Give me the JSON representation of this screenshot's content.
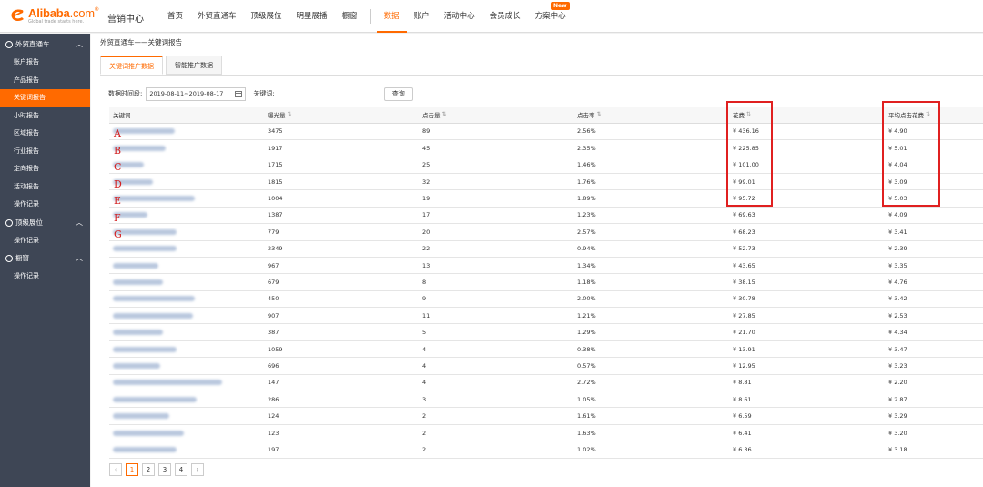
{
  "header": {
    "logo_main": "Alibaba",
    "logo_dom": ".com",
    "logo_reg": "®",
    "logo_sub": "Global trade starts here.",
    "title": "营销中心",
    "nav": [
      "首页",
      "外贸直通车",
      "顶级展位",
      "明星展播",
      "橱窗"
    ],
    "nav2": [
      "数据",
      "账户",
      "活动中心",
      "会员成长",
      "方案中心"
    ],
    "active": "数据",
    "new_badge": "New",
    "accent": "#ff6a00"
  },
  "sidebar": {
    "groups": [
      {
        "label": "外贸直通车",
        "items": [
          "账户报告",
          "产品报告",
          "关键词报告",
          "小时报告",
          "区域报告",
          "行业报告",
          "定向报告",
          "活动报告",
          "操作记录"
        ]
      },
      {
        "label": "顶级展位",
        "items": [
          "操作记录"
        ]
      },
      {
        "label": "橱窗",
        "items": [
          "操作记录"
        ]
      }
    ],
    "active_item": "关键词报告",
    "bg": "#3e4655"
  },
  "main": {
    "breadcrumb": "外贸直通车——关键词报告",
    "tabs": [
      "关键词推广数据",
      "智能推广数据"
    ],
    "filters": {
      "date_label": "数据时间段:",
      "date_value": "2019-08-11~2019-08-17",
      "keyword_label": "关键词:",
      "query_button": "查询"
    },
    "columns": [
      "关键词",
      "曝光量",
      "点击量",
      "点击率",
      "花费",
      "平均点击花费"
    ],
    "rows": [
      {
        "imp": "3475",
        "clk": "89",
        "ctr": "2.56%",
        "cost": "¥ 436.16",
        "cpc": "¥ 4.90"
      },
      {
        "imp": "1917",
        "clk": "45",
        "ctr": "2.35%",
        "cost": "¥ 225.85",
        "cpc": "¥ 5.01"
      },
      {
        "imp": "1715",
        "clk": "25",
        "ctr": "1.46%",
        "cost": "¥ 101.00",
        "cpc": "¥ 4.04"
      },
      {
        "imp": "1815",
        "clk": "32",
        "ctr": "1.76%",
        "cost": "¥ 99.01",
        "cpc": "¥ 3.09"
      },
      {
        "imp": "1004",
        "clk": "19",
        "ctr": "1.89%",
        "cost": "¥ 95.72",
        "cpc": "¥ 5.03"
      },
      {
        "imp": "1387",
        "clk": "17",
        "ctr": "1.23%",
        "cost": "¥ 69.63",
        "cpc": "¥ 4.09"
      },
      {
        "imp": "779",
        "clk": "20",
        "ctr": "2.57%",
        "cost": "¥ 68.23",
        "cpc": "¥ 3.41"
      },
      {
        "imp": "2349",
        "clk": "22",
        "ctr": "0.94%",
        "cost": "¥ 52.73",
        "cpc": "¥ 2.39"
      },
      {
        "imp": "967",
        "clk": "13",
        "ctr": "1.34%",
        "cost": "¥ 43.65",
        "cpc": "¥ 3.35"
      },
      {
        "imp": "679",
        "clk": "8",
        "ctr": "1.18%",
        "cost": "¥ 38.15",
        "cpc": "¥ 4.76"
      },
      {
        "imp": "450",
        "clk": "9",
        "ctr": "2.00%",
        "cost": "¥ 30.78",
        "cpc": "¥ 3.42"
      },
      {
        "imp": "907",
        "clk": "11",
        "ctr": "1.21%",
        "cost": "¥ 27.85",
        "cpc": "¥ 2.53"
      },
      {
        "imp": "387",
        "clk": "5",
        "ctr": "1.29%",
        "cost": "¥ 21.70",
        "cpc": "¥ 4.34"
      },
      {
        "imp": "1059",
        "clk": "4",
        "ctr": "0.38%",
        "cost": "¥ 13.91",
        "cpc": "¥ 3.47"
      },
      {
        "imp": "696",
        "clk": "4",
        "ctr": "0.57%",
        "cost": "¥ 12.95",
        "cpc": "¥ 3.23"
      },
      {
        "imp": "147",
        "clk": "4",
        "ctr": "2.72%",
        "cost": "¥ 8.81",
        "cpc": "¥ 2.20"
      },
      {
        "imp": "286",
        "clk": "3",
        "ctr": "1.05%",
        "cost": "¥ 8.61",
        "cpc": "¥ 2.87"
      },
      {
        "imp": "124",
        "clk": "2",
        "ctr": "1.61%",
        "cost": "¥ 6.59",
        "cpc": "¥ 3.29"
      },
      {
        "imp": "123",
        "clk": "2",
        "ctr": "1.63%",
        "cost": "¥ 6.41",
        "cpc": "¥ 3.20"
      },
      {
        "imp": "197",
        "clk": "2",
        "ctr": "1.02%",
        "cost": "¥ 6.36",
        "cpc": "¥ 3.18"
      }
    ],
    "annotation_letters": [
      "A",
      "B",
      "C",
      "D",
      "E",
      "F",
      "G"
    ],
    "pager": {
      "pages": [
        "1",
        "2",
        "3",
        "4"
      ],
      "current": "1",
      "prev": "‹",
      "next": "›"
    }
  }
}
